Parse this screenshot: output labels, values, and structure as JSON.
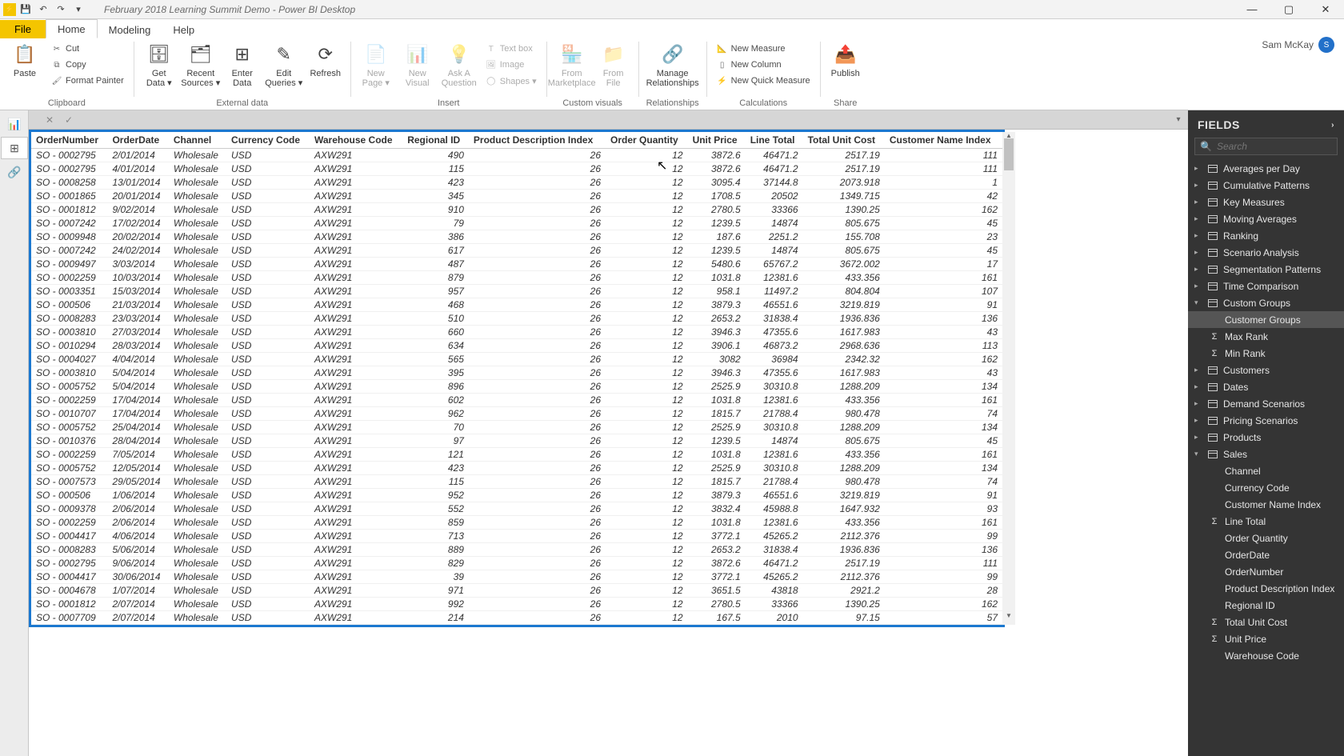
{
  "titlebar": {
    "title": "February 2018 Learning Summit Demo - Power BI Desktop"
  },
  "window": {
    "minimize": "—",
    "maximize": "▢",
    "close": "✕"
  },
  "tabs": {
    "file": "File",
    "home": "Home",
    "modeling": "Modeling",
    "help": "Help"
  },
  "ribbon": {
    "clipboard": {
      "label": "Clipboard",
      "paste": "Paste",
      "cut": "Cut",
      "copy": "Copy",
      "fmtpaint": "Format Painter"
    },
    "externaldata": {
      "label": "External data",
      "getdata": "Get\nData ▾",
      "recent": "Recent\nSources ▾",
      "enter": "Enter\nData",
      "edit": "Edit\nQueries ▾",
      "refresh": "Refresh"
    },
    "insert": {
      "label": "Insert",
      "newpage": "New\nPage ▾",
      "newvisual": "New\nVisual",
      "ask": "Ask A\nQuestion",
      "textbox": "Text box",
      "image": "Image",
      "shapes": "Shapes ▾"
    },
    "customvisuals": {
      "label": "Custom visuals",
      "market": "From\nMarketplace",
      "file": "From\nFile"
    },
    "relationships": {
      "label": "Relationships",
      "manage": "Manage\nRelationships"
    },
    "calculations": {
      "label": "Calculations",
      "measure": "New Measure",
      "column": "New Column",
      "quick": "New Quick Measure"
    },
    "share": {
      "label": "Share",
      "publish": "Publish"
    }
  },
  "user": {
    "name": "Sam McKay"
  },
  "fields": {
    "title": "FIELDS",
    "search_ph": "Search",
    "items": [
      {
        "label": "Averages per Day",
        "type": "table"
      },
      {
        "label": "Cumulative Patterns",
        "type": "table"
      },
      {
        "label": "Key Measures",
        "type": "table"
      },
      {
        "label": "Moving Averages",
        "type": "table"
      },
      {
        "label": "Ranking",
        "type": "table"
      },
      {
        "label": "Scenario Analysis",
        "type": "table"
      },
      {
        "label": "Segmentation Patterns",
        "type": "table"
      },
      {
        "label": "Time Comparison",
        "type": "table"
      },
      {
        "label": "Custom Groups",
        "type": "table",
        "expanded": true,
        "children": [
          {
            "label": "Customer Groups",
            "selected": true
          },
          {
            "label": "Max Rank",
            "sigma": true
          },
          {
            "label": "Min Rank",
            "sigma": true
          }
        ]
      },
      {
        "label": "Customers",
        "type": "table"
      },
      {
        "label": "Dates",
        "type": "table"
      },
      {
        "label": "Demand Scenarios",
        "type": "table"
      },
      {
        "label": "Pricing Scenarios",
        "type": "table"
      },
      {
        "label": "Products",
        "type": "table"
      },
      {
        "label": "Sales",
        "type": "table",
        "expanded": true,
        "children": [
          {
            "label": "Channel"
          },
          {
            "label": "Currency Code"
          },
          {
            "label": "Customer Name Index"
          },
          {
            "label": "Line Total",
            "sigma": true
          },
          {
            "label": "Order Quantity"
          },
          {
            "label": "OrderDate"
          },
          {
            "label": "OrderNumber"
          },
          {
            "label": "Product Description Index"
          },
          {
            "label": "Regional ID"
          },
          {
            "label": "Total Unit Cost",
            "sigma": true
          },
          {
            "label": "Unit Price",
            "sigma": true
          },
          {
            "label": "Warehouse Code"
          }
        ]
      }
    ]
  },
  "table": {
    "columns": [
      "OrderNumber",
      "OrderDate",
      "Channel",
      "Currency Code",
      "Warehouse Code",
      "Regional ID",
      "Product Description Index",
      "Order Quantity",
      "Unit Price",
      "Line Total",
      "Total Unit Cost",
      "Customer Name Index"
    ],
    "rows": [
      [
        "SO - 0002795",
        "2/01/2014",
        "Wholesale",
        "USD",
        "AXW291",
        "490",
        "26",
        "12",
        "3872.6",
        "46471.2",
        "2517.19",
        "111"
      ],
      [
        "SO - 0002795",
        "4/01/2014",
        "Wholesale",
        "USD",
        "AXW291",
        "115",
        "26",
        "12",
        "3872.6",
        "46471.2",
        "2517.19",
        "111"
      ],
      [
        "SO - 0008258",
        "13/01/2014",
        "Wholesale",
        "USD",
        "AXW291",
        "423",
        "26",
        "12",
        "3095.4",
        "37144.8",
        "2073.918",
        "1"
      ],
      [
        "SO - 0001865",
        "20/01/2014",
        "Wholesale",
        "USD",
        "AXW291",
        "345",
        "26",
        "12",
        "1708.5",
        "20502",
        "1349.715",
        "42"
      ],
      [
        "SO - 0001812",
        "9/02/2014",
        "Wholesale",
        "USD",
        "AXW291",
        "910",
        "26",
        "12",
        "2780.5",
        "33366",
        "1390.25",
        "162"
      ],
      [
        "SO - 0007242",
        "17/02/2014",
        "Wholesale",
        "USD",
        "AXW291",
        "79",
        "26",
        "12",
        "1239.5",
        "14874",
        "805.675",
        "45"
      ],
      [
        "SO - 0009948",
        "20/02/2014",
        "Wholesale",
        "USD",
        "AXW291",
        "386",
        "26",
        "12",
        "187.6",
        "2251.2",
        "155.708",
        "23"
      ],
      [
        "SO - 0007242",
        "24/02/2014",
        "Wholesale",
        "USD",
        "AXW291",
        "617",
        "26",
        "12",
        "1239.5",
        "14874",
        "805.675",
        "45"
      ],
      [
        "SO - 0009497",
        "3/03/2014",
        "Wholesale",
        "USD",
        "AXW291",
        "487",
        "26",
        "12",
        "5480.6",
        "65767.2",
        "3672.002",
        "17"
      ],
      [
        "SO - 0002259",
        "10/03/2014",
        "Wholesale",
        "USD",
        "AXW291",
        "879",
        "26",
        "12",
        "1031.8",
        "12381.6",
        "433.356",
        "161"
      ],
      [
        "SO - 0003351",
        "15/03/2014",
        "Wholesale",
        "USD",
        "AXW291",
        "957",
        "26",
        "12",
        "958.1",
        "11497.2",
        "804.804",
        "107"
      ],
      [
        "SO - 000506",
        "21/03/2014",
        "Wholesale",
        "USD",
        "AXW291",
        "468",
        "26",
        "12",
        "3879.3",
        "46551.6",
        "3219.819",
        "91"
      ],
      [
        "SO - 0008283",
        "23/03/2014",
        "Wholesale",
        "USD",
        "AXW291",
        "510",
        "26",
        "12",
        "2653.2",
        "31838.4",
        "1936.836",
        "136"
      ],
      [
        "SO - 0003810",
        "27/03/2014",
        "Wholesale",
        "USD",
        "AXW291",
        "660",
        "26",
        "12",
        "3946.3",
        "47355.6",
        "1617.983",
        "43"
      ],
      [
        "SO - 0010294",
        "28/03/2014",
        "Wholesale",
        "USD",
        "AXW291",
        "634",
        "26",
        "12",
        "3906.1",
        "46873.2",
        "2968.636",
        "113"
      ],
      [
        "SO - 0004027",
        "4/04/2014",
        "Wholesale",
        "USD",
        "AXW291",
        "565",
        "26",
        "12",
        "3082",
        "36984",
        "2342.32",
        "162"
      ],
      [
        "SO - 0003810",
        "5/04/2014",
        "Wholesale",
        "USD",
        "AXW291",
        "395",
        "26",
        "12",
        "3946.3",
        "47355.6",
        "1617.983",
        "43"
      ],
      [
        "SO - 0005752",
        "5/04/2014",
        "Wholesale",
        "USD",
        "AXW291",
        "896",
        "26",
        "12",
        "2525.9",
        "30310.8",
        "1288.209",
        "134"
      ],
      [
        "SO - 0002259",
        "17/04/2014",
        "Wholesale",
        "USD",
        "AXW291",
        "602",
        "26",
        "12",
        "1031.8",
        "12381.6",
        "433.356",
        "161"
      ],
      [
        "SO - 0010707",
        "17/04/2014",
        "Wholesale",
        "USD",
        "AXW291",
        "962",
        "26",
        "12",
        "1815.7",
        "21788.4",
        "980.478",
        "74"
      ],
      [
        "SO - 0005752",
        "25/04/2014",
        "Wholesale",
        "USD",
        "AXW291",
        "70",
        "26",
        "12",
        "2525.9",
        "30310.8",
        "1288.209",
        "134"
      ],
      [
        "SO - 0010376",
        "28/04/2014",
        "Wholesale",
        "USD",
        "AXW291",
        "97",
        "26",
        "12",
        "1239.5",
        "14874",
        "805.675",
        "45"
      ],
      [
        "SO - 0002259",
        "7/05/2014",
        "Wholesale",
        "USD",
        "AXW291",
        "121",
        "26",
        "12",
        "1031.8",
        "12381.6",
        "433.356",
        "161"
      ],
      [
        "SO - 0005752",
        "12/05/2014",
        "Wholesale",
        "USD",
        "AXW291",
        "423",
        "26",
        "12",
        "2525.9",
        "30310.8",
        "1288.209",
        "134"
      ],
      [
        "SO - 0007573",
        "29/05/2014",
        "Wholesale",
        "USD",
        "AXW291",
        "115",
        "26",
        "12",
        "1815.7",
        "21788.4",
        "980.478",
        "74"
      ],
      [
        "SO - 000506",
        "1/06/2014",
        "Wholesale",
        "USD",
        "AXW291",
        "952",
        "26",
        "12",
        "3879.3",
        "46551.6",
        "3219.819",
        "91"
      ],
      [
        "SO - 0009378",
        "2/06/2014",
        "Wholesale",
        "USD",
        "AXW291",
        "552",
        "26",
        "12",
        "3832.4",
        "45988.8",
        "1647.932",
        "93"
      ],
      [
        "SO - 0002259",
        "2/06/2014",
        "Wholesale",
        "USD",
        "AXW291",
        "859",
        "26",
        "12",
        "1031.8",
        "12381.6",
        "433.356",
        "161"
      ],
      [
        "SO - 0004417",
        "4/06/2014",
        "Wholesale",
        "USD",
        "AXW291",
        "713",
        "26",
        "12",
        "3772.1",
        "45265.2",
        "2112.376",
        "99"
      ],
      [
        "SO - 0008283",
        "5/06/2014",
        "Wholesale",
        "USD",
        "AXW291",
        "889",
        "26",
        "12",
        "2653.2",
        "31838.4",
        "1936.836",
        "136"
      ],
      [
        "SO - 0002795",
        "9/06/2014",
        "Wholesale",
        "USD",
        "AXW291",
        "829",
        "26",
        "12",
        "3872.6",
        "46471.2",
        "2517.19",
        "111"
      ],
      [
        "SO - 0004417",
        "30/06/2014",
        "Wholesale",
        "USD",
        "AXW291",
        "39",
        "26",
        "12",
        "3772.1",
        "45265.2",
        "2112.376",
        "99"
      ],
      [
        "SO - 0004678",
        "1/07/2014",
        "Wholesale",
        "USD",
        "AXW291",
        "971",
        "26",
        "12",
        "3651.5",
        "43818",
        "2921.2",
        "28"
      ],
      [
        "SO - 0001812",
        "2/07/2014",
        "Wholesale",
        "USD",
        "AXW291",
        "992",
        "26",
        "12",
        "2780.5",
        "33366",
        "1390.25",
        "162"
      ],
      [
        "SO - 0007709",
        "2/07/2014",
        "Wholesale",
        "USD",
        "AXW291",
        "214",
        "26",
        "12",
        "167.5",
        "2010",
        "97.15",
        "57"
      ]
    ]
  }
}
